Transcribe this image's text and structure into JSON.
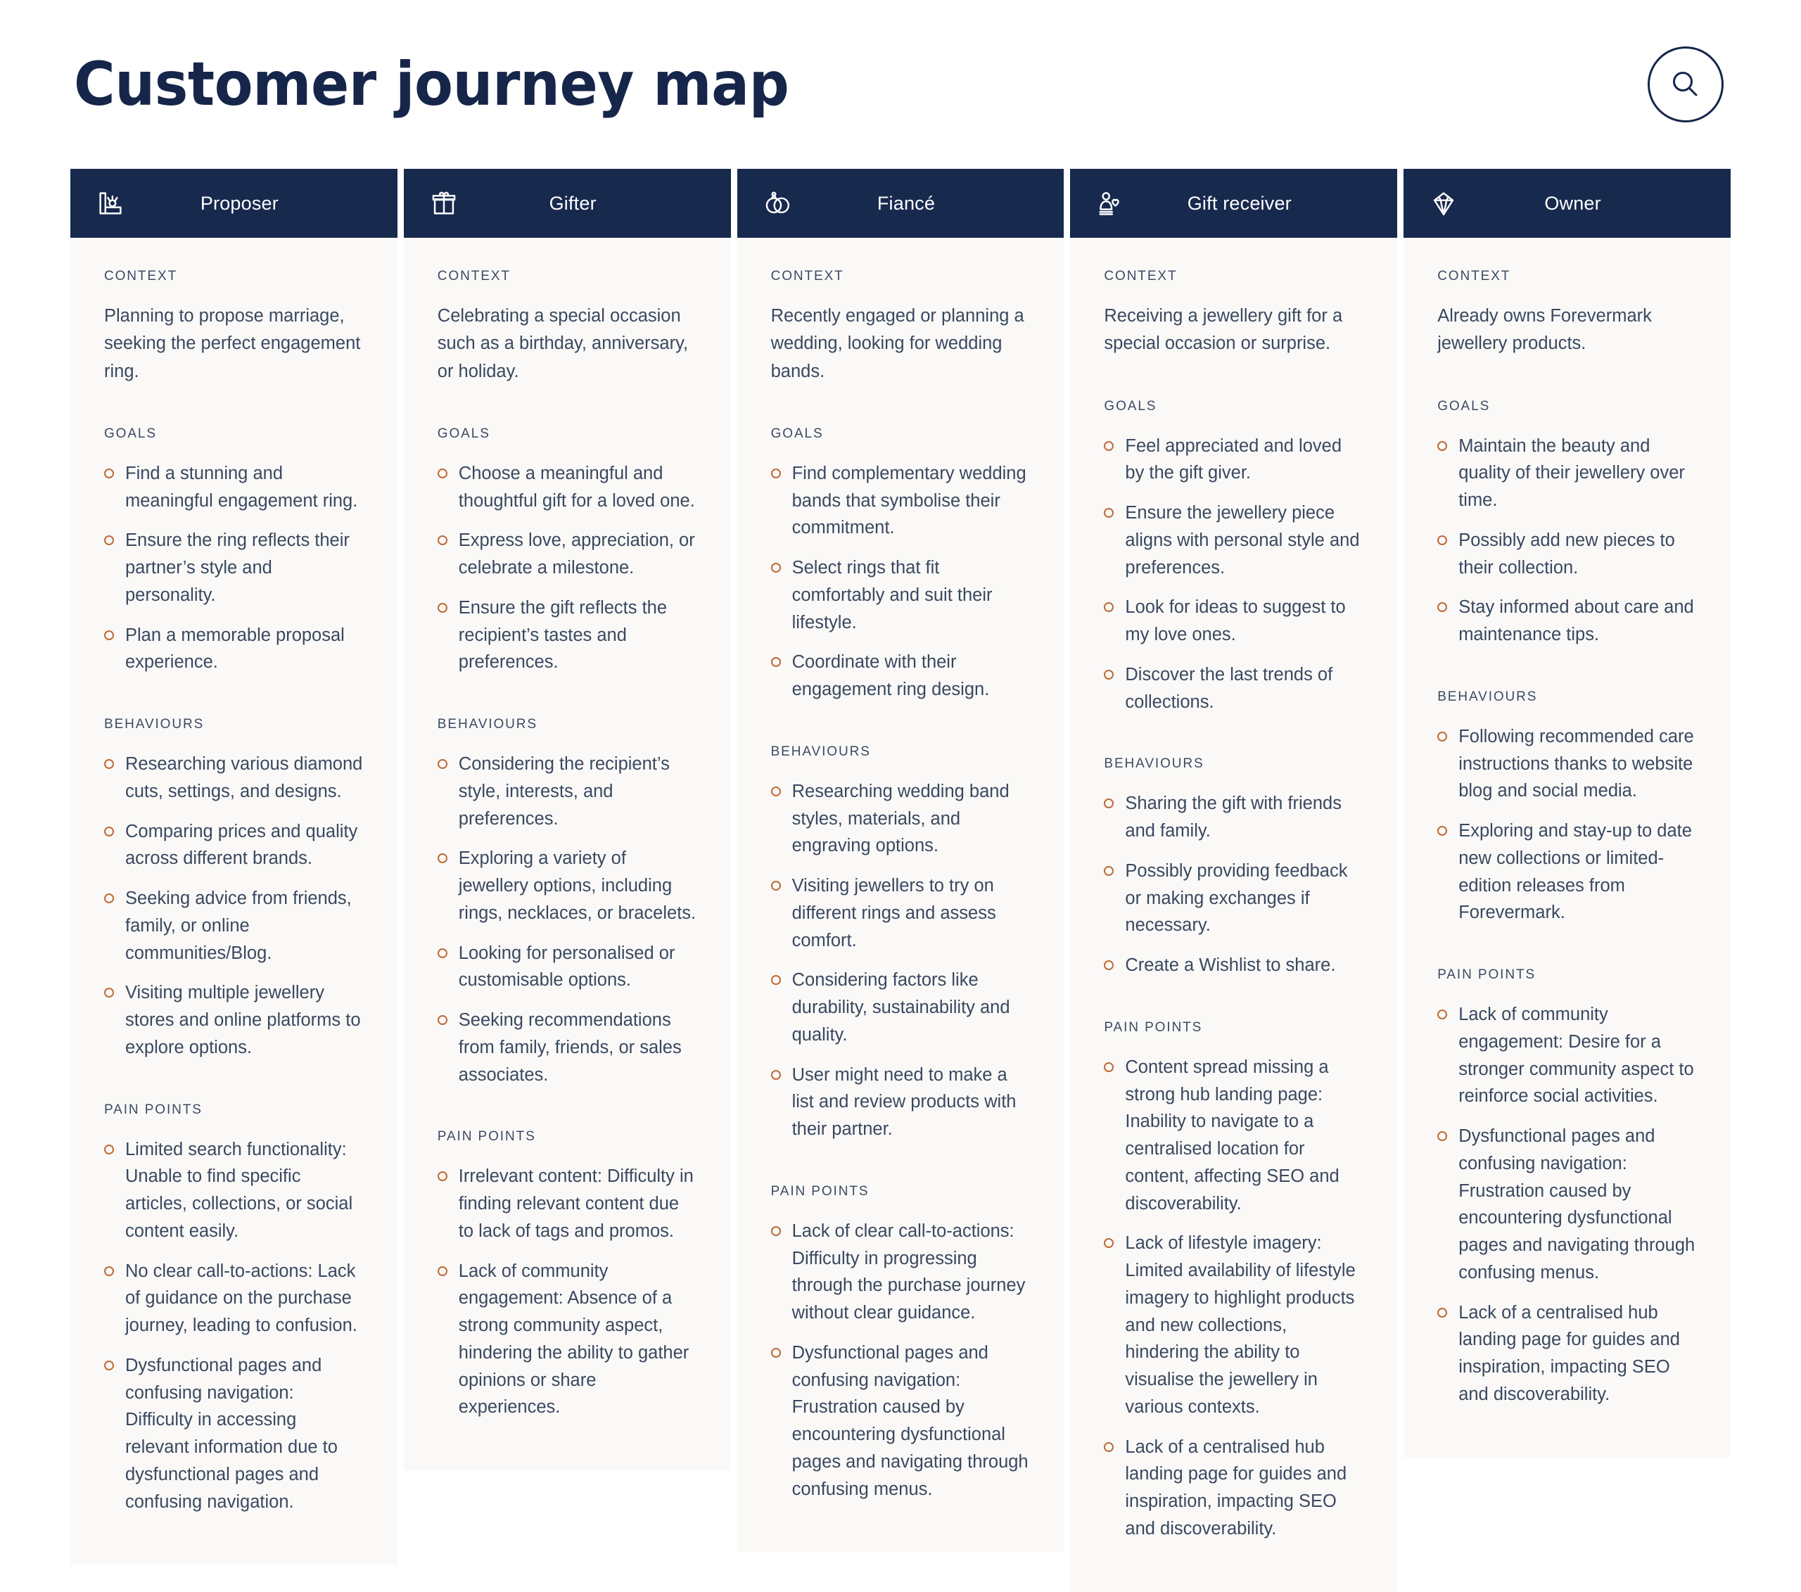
{
  "header": {
    "title": "Customer journey map",
    "search_icon": "search-icon"
  },
  "section_labels": {
    "context": "CONTEXT",
    "goals": "GOALS",
    "behaviours": "BEHAVIOURS",
    "pain_points": "PAIN POINTS"
  },
  "colors": {
    "header_navy": "#18294e",
    "title_navy": "#16264a",
    "card_background": "#faf9f7",
    "bullet_orange": "#c06a36",
    "body_text": "#3a4860"
  },
  "columns": [
    {
      "label": "Proposer",
      "icon": "ring-box-icon",
      "context": "Planning to propose marriage, seeking the perfect engagement ring.",
      "goals": [
        "Find a stunning and meaningful engagement ring.",
        "Ensure the ring reflects their partner’s style and personality.",
        "Plan a memorable proposal experience."
      ],
      "behaviours": [
        "Researching various diamond cuts, settings, and designs.",
        "Comparing prices and quality across different brands.",
        "Seeking advice from friends, family, or online communities/Blog.",
        "Visiting multiple jewellery stores and online platforms to explore options."
      ],
      "pain_points": [
        "Limited search functionality: Unable to find specific articles, collections, or social content easily.",
        "No clear call-to-actions: Lack of guidance on the purchase journey, leading to confusion.",
        "Dysfunctional pages and confusing navigation: Difficulty in accessing relevant information due to dysfunctional pages and confusing navigation."
      ]
    },
    {
      "label": "Gifter",
      "icon": "gift-box-icon",
      "context": "Celebrating a special occasion such as a birthday, anniversary, or holiday.",
      "goals": [
        "Choose a meaningful and thoughtful gift for a loved one.",
        "Express love, appreciation, or celebrate a milestone.",
        "Ensure the gift reflects the recipient’s tastes and preferences."
      ],
      "behaviours": [
        "Considering the recipient’s style, interests, and preferences.",
        "Exploring a variety of jewellery options, including rings, necklaces, or bracelets.",
        "Looking for personalised or customisable options.",
        "Seeking recommendations from family, friends, or sales associates."
      ],
      "pain_points": [
        "Irrelevant content: Difficulty in finding relevant content due to lack of tags and promos.",
        "Lack of community engagement: Absence of a strong community aspect, hindering the ability to gather opinions or share experiences."
      ]
    },
    {
      "label": "Fiancé",
      "icon": "wedding-rings-icon",
      "context": "Recently engaged or planning a wedding, looking for wedding bands.",
      "goals": [
        "Find complementary wedding bands that symbolise their commitment.",
        "Select rings that fit comfortably and suit their lifestyle.",
        "Coordinate with their engagement ring design."
      ],
      "behaviours": [
        "Researching wedding band styles, materials, and engraving options.",
        "Visiting jewellers to try on different rings and assess comfort.",
        "Considering factors like durability, sustainability and quality.",
        "User might need to make a list and review products with their partner."
      ],
      "pain_points": [
        "Lack of clear call-to-actions: Difficulty in progressing through the purchase journey without clear guidance.",
        "Dysfunctional pages and confusing navigation: Frustration caused by encountering dysfunctional pages and navigating through confusing menus."
      ]
    },
    {
      "label": "Gift receiver",
      "icon": "person-heart-icon",
      "context": "Receiving a jewellery gift for a special occasion or surprise.",
      "goals": [
        "Feel appreciated and loved by the gift giver.",
        "Ensure the jewellery piece aligns with personal style and preferences.",
        "Look for ideas to suggest to my love ones.",
        "Discover the last trends of collections."
      ],
      "behaviours": [
        "Sharing the gift with friends and family.",
        "Possibly providing feedback or making exchanges if necessary.",
        "Create a Wishlist to share."
      ],
      "pain_points": [
        "Content spread missing a strong hub landing page: Inability to navigate to a centralised location for content, affecting SEO and discoverability.",
        "Lack of lifestyle imagery: Limited availability of lifestyle imagery to highlight products and new collections, hindering the ability to visualise the jewellery in various contexts.",
        "Lack of a centralised hub landing page for guides and inspiration, impacting SEO and discoverability."
      ]
    },
    {
      "label": "Owner",
      "icon": "diamond-icon",
      "context": "Already owns Forevermark jewellery products.",
      "goals": [
        "Maintain the beauty and quality of their jewellery over time.",
        "Possibly add new pieces to their collection.",
        "Stay informed about care and maintenance tips."
      ],
      "behaviours": [
        "Following recommended care instructions thanks to website blog and social media.",
        "Exploring and stay-up to date new collections or limited-edition releases from Forevermark."
      ],
      "pain_points": [
        "Lack of community engagement: Desire for a stronger community aspect to reinforce social activities.",
        "Dysfunctional pages and confusing navigation: Frustration caused by encountering dysfunctional pages and navigating through confusing menus.",
        "Lack of a centralised hub landing page for guides and inspiration, impacting SEO and discoverability."
      ]
    }
  ]
}
